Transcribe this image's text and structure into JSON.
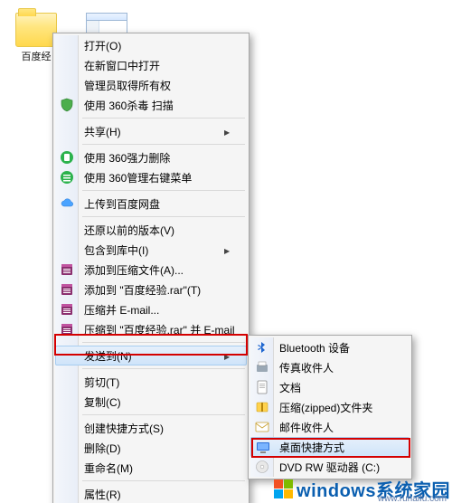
{
  "desktop": {
    "icons": [
      {
        "name": "百度经"
      },
      {
        "name": ""
      }
    ]
  },
  "menu": {
    "items": [
      {
        "kind": "item",
        "icon": "",
        "label": "打开(O)"
      },
      {
        "kind": "item",
        "icon": "",
        "label": "在新窗口中打开"
      },
      {
        "kind": "item",
        "icon": "",
        "label": "管理员取得所有权"
      },
      {
        "kind": "item",
        "icon": "shield",
        "label": "使用 360杀毒 扫描"
      },
      {
        "kind": "sep"
      },
      {
        "kind": "item",
        "icon": "",
        "label": "共享(H)",
        "submenu": true
      },
      {
        "kind": "sep"
      },
      {
        "kind": "item",
        "icon": "delete360",
        "label": "使用 360强力删除"
      },
      {
        "kind": "item",
        "icon": "menu360",
        "label": "使用 360管理右键菜单"
      },
      {
        "kind": "sep"
      },
      {
        "kind": "item",
        "icon": "cloud",
        "label": "上传到百度网盘"
      },
      {
        "kind": "sep"
      },
      {
        "kind": "item",
        "icon": "",
        "label": "还原以前的版本(V)"
      },
      {
        "kind": "item",
        "icon": "",
        "label": "包含到库中(I)",
        "submenu": true
      },
      {
        "kind": "item",
        "icon": "rar",
        "label": "添加到压缩文件(A)..."
      },
      {
        "kind": "item",
        "icon": "rar",
        "label": "添加到 \"百度经验.rar\"(T)"
      },
      {
        "kind": "item",
        "icon": "rar",
        "label": "压缩并 E-mail..."
      },
      {
        "kind": "item",
        "icon": "rar",
        "label": "压缩到 \"百度经验.rar\" 并 E-mail"
      },
      {
        "kind": "sep"
      },
      {
        "kind": "item",
        "icon": "",
        "label": "发送到(N)",
        "submenu": true,
        "hover": true
      },
      {
        "kind": "sep"
      },
      {
        "kind": "item",
        "icon": "",
        "label": "剪切(T)"
      },
      {
        "kind": "item",
        "icon": "",
        "label": "复制(C)"
      },
      {
        "kind": "sep"
      },
      {
        "kind": "item",
        "icon": "",
        "label": "创建快捷方式(S)"
      },
      {
        "kind": "item",
        "icon": "",
        "label": "删除(D)"
      },
      {
        "kind": "item",
        "icon": "",
        "label": "重命名(M)"
      },
      {
        "kind": "sep"
      },
      {
        "kind": "item",
        "icon": "",
        "label": "属性(R)"
      }
    ]
  },
  "submenu": {
    "items": [
      {
        "icon": "bluetooth",
        "label": "Bluetooth 设备"
      },
      {
        "icon": "fax",
        "label": "传真收件人"
      },
      {
        "icon": "doc",
        "label": "文档"
      },
      {
        "icon": "zip",
        "label": "压缩(zipped)文件夹"
      },
      {
        "icon": "mail",
        "label": "邮件收件人"
      },
      {
        "icon": "desktop",
        "label": "桌面快捷方式",
        "hover": true
      },
      {
        "icon": "dvd",
        "label": "DVD RW 驱动器 (C:)"
      }
    ]
  },
  "watermark": {
    "text1": "windows",
    "text2": "系统家园",
    "sub": "www.ruhaifu.com"
  }
}
